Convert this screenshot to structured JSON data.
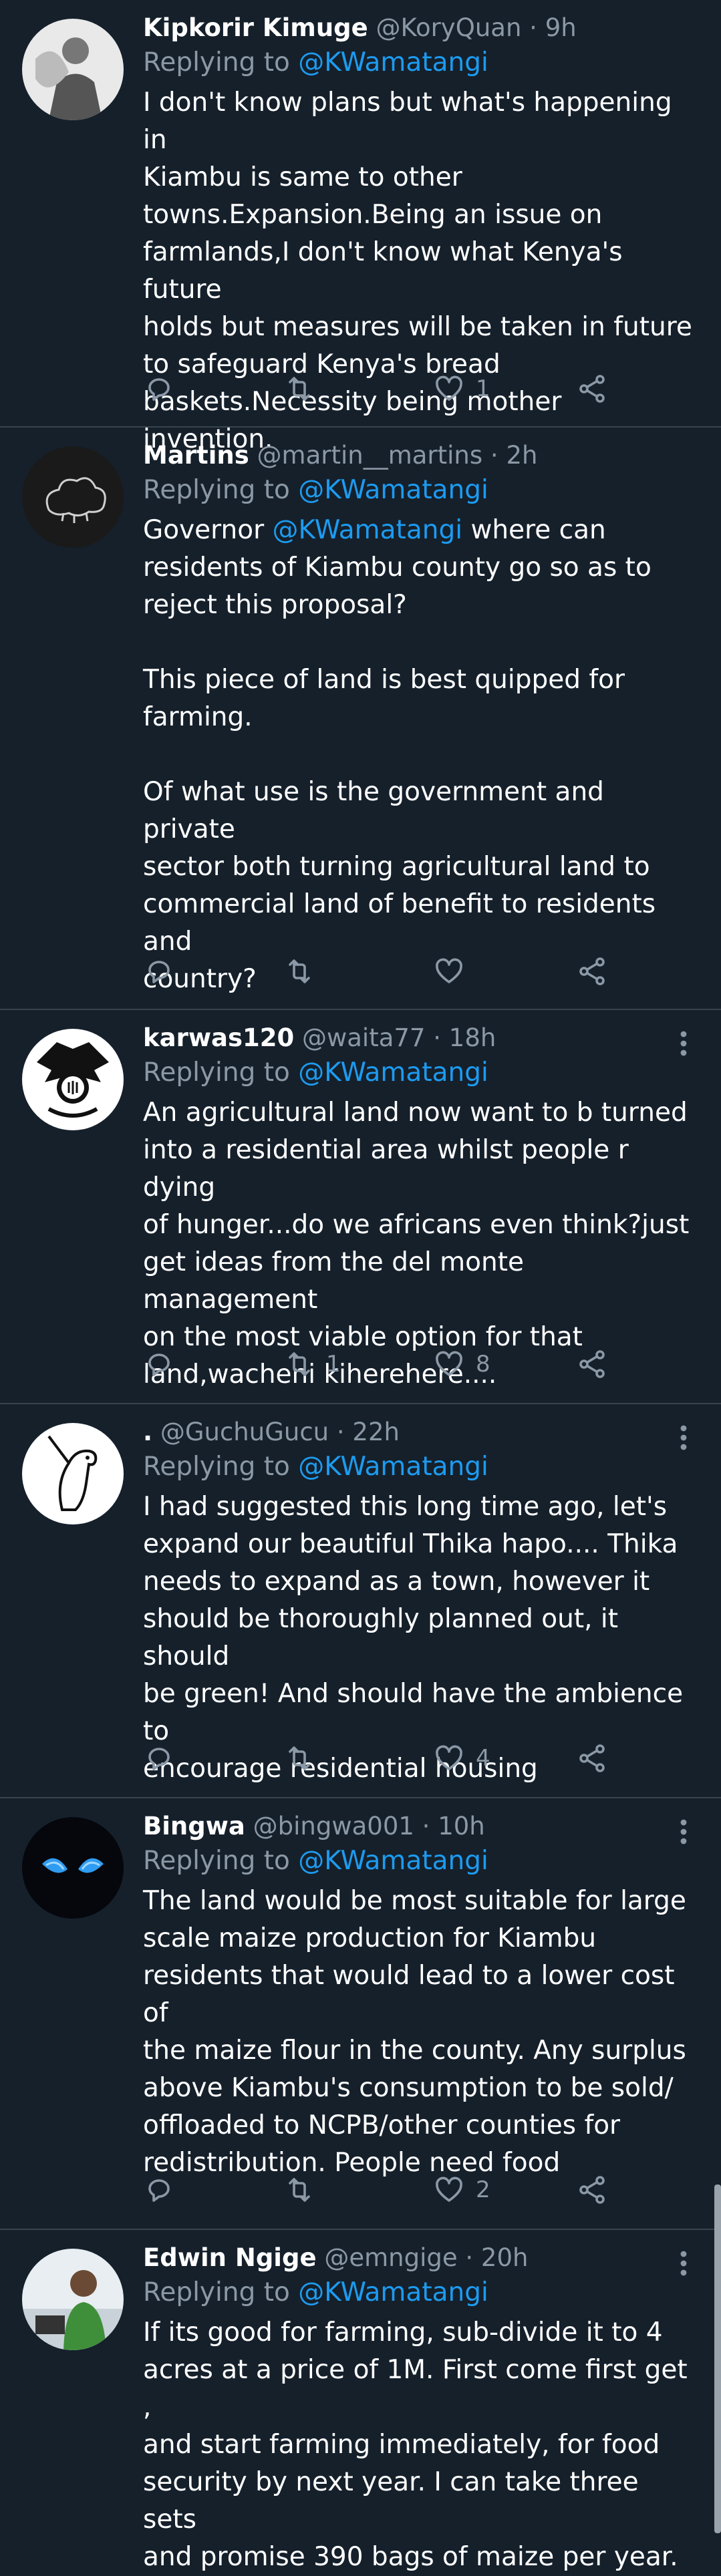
{
  "colors": {
    "background": "#15202b",
    "divider": "#38444d",
    "secondary_text": "#8b98a5",
    "link": "#1d9bf0"
  },
  "tweets": [
    {
      "name": "Kipkorir Kimuge",
      "handle": "@KoryQuan",
      "time": "9h",
      "replying_label": "Replying to",
      "replying_to": "@KWamatangi",
      "body_parts": [
        {
          "text": "I don't know plans but what's happening in\nKiambu is same to other\ntowns.Expansion.Being an issue on\nfarmlands,I don't know what Kenya's future\nholds but measures will be taken in future\nto safeguard Kenya's bread\nbaskets.Necessity being mother invention."
        }
      ],
      "replies": "",
      "retweets": "",
      "likes": "1",
      "avatar": "avatar-photo-icon"
    },
    {
      "name": "Martins",
      "handle": "@martin__martins",
      "time": "2h",
      "replying_label": "Replying to",
      "replying_to": "@KWamatangi",
      "body_parts": [
        {
          "text": "Governor "
        },
        {
          "text": "@KWamatangi",
          "mention": true
        },
        {
          "text": " where can\nresidents of Kiambu county go so as to\nreject this proposal?\n\nThis piece of land is best quipped for\nfarming.\n\nOf what use is the government and private\nsector both turning agricultural land to\ncommercial land of benefit to residents and\ncountry?"
        }
      ],
      "replies": "",
      "retweets": "",
      "likes": "",
      "avatar": "cloud-sketch-icon"
    },
    {
      "name": "karwas120",
      "handle": "@waita77",
      "time": "18h",
      "replying_label": "Replying to",
      "replying_to": "@KWamatangi",
      "body_parts": [
        {
          "text": "An agricultural land now want to b turned\ninto a residential area whilst people r dying\nof hunger...do we africans even think?just\nget ideas from the del monte management\non the most viable option for that\nland,wacheni kiherehere...."
        }
      ],
      "replies": "",
      "retweets": "1",
      "likes": "8",
      "avatar": "eagle-emblem-icon"
    },
    {
      "name": ".",
      "handle": "@GuchuGucu",
      "time": "22h",
      "replying_label": "Replying to",
      "replying_to": "@KWamatangi",
      "body_parts": [
        {
          "text": "I had suggested this long time ago, let's\nexpand our beautiful Thika hapo.... Thika\nneeds to expand as a town, however it\nshould be thoroughly planned out, it should\nbe green! And should have the ambience to\nencourage residential housing"
        }
      ],
      "replies": "",
      "retweets": "",
      "likes": "4",
      "avatar": "bird-sketch-icon"
    },
    {
      "name": "Bingwa",
      "handle": "@bingwa001",
      "time": "10h",
      "replying_label": "Replying to",
      "replying_to": "@KWamatangi",
      "body_parts": [
        {
          "text": "The land would be most suitable for large\nscale maize production for Kiambu\nresidents that would lead to a lower cost of\nthe maize flour in the county. Any surplus\nabove Kiambu's consumption to be sold/\noffloaded to NCPB/other counties for\nredistribution. People need food"
        }
      ],
      "replies": "",
      "retweets": "",
      "likes": "2",
      "avatar": "blue-eyes-icon"
    },
    {
      "name": "Edwin Ngige",
      "handle": "@emngige",
      "time": "20h",
      "replying_label": "Replying to",
      "replying_to": "@KWamatangi",
      "body_parts": [
        {
          "text": "If its good for farming, sub-divide it to 4\nacres at a price of 1M. First come first get ,\nand start farming immediately, for food\nsecurity by next year. I can take three sets\nand promise 390 bags of maize per year."
        }
      ],
      "replies": "",
      "retweets": "",
      "likes": "",
      "avatar": "person-photo-icon"
    }
  ]
}
